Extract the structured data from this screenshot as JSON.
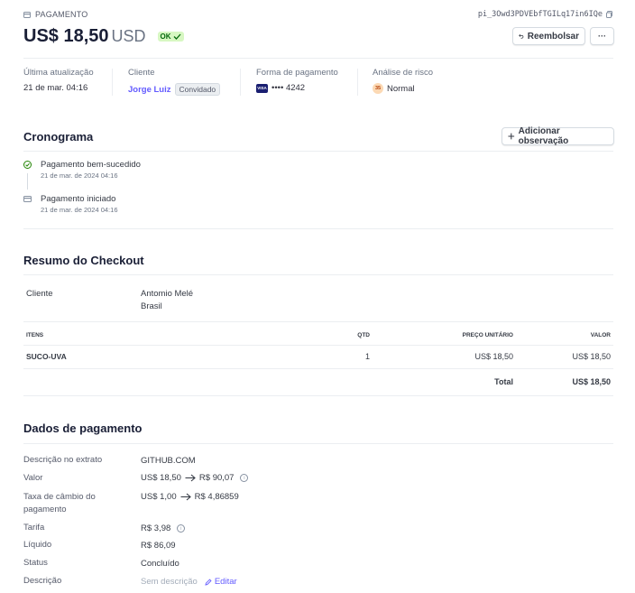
{
  "header": {
    "kicker": "PAGAMENTO",
    "payment_id": "pi_3Owd3PDVEbfTGILq17in6IQe",
    "amount": "US$ 18,50",
    "currency": "USD",
    "status_badge": "OK",
    "refund_label": "Reembolsar",
    "more_label": "···"
  },
  "summary": {
    "last_update_label": "Última atualização",
    "last_update_value": "21 de mar. 04:16",
    "customer_label": "Cliente",
    "customer_name": "Jorge Luiz",
    "customer_badge": "Convidado",
    "payment_method_label": "Forma de pagamento",
    "card_brand": "VISA",
    "card_last4": "•••• 4242",
    "risk_label": "Análise de risco",
    "risk_score": "35",
    "risk_level": "Normal"
  },
  "timeline": {
    "title": "Cronograma",
    "add_note_label": "Adicionar observação",
    "events": [
      {
        "title": "Pagamento bem-sucedido",
        "time": "21 de mar. de 2024 04:16"
      },
      {
        "title": "Pagamento iniciado",
        "time": "21 de mar. de 2024 04:16"
      }
    ]
  },
  "checkout": {
    "title": "Resumo do Checkout",
    "customer_label": "Cliente",
    "customer_name": "Antomio Melé",
    "customer_country": "Brasil",
    "columns": {
      "items": "ITENS",
      "qty": "QTD",
      "unit_price": "PREÇO UNITÁRIO",
      "value": "VALOR"
    },
    "rows": [
      {
        "item": "SUCO-UVA",
        "qty": "1",
        "unit_price": "US$ 18,50",
        "value": "US$ 18,50"
      }
    ],
    "total_label": "Total",
    "total_value": "US$ 18,50"
  },
  "payment_details": {
    "title": "Dados de pagamento",
    "statement_label": "Descrição no extrato",
    "statement_value": "GITHUB.COM",
    "value_label": "Valor",
    "value_from": "US$ 18,50",
    "value_to": "R$ 90,07",
    "fx_label": "Taxa de câmbio do pagamento",
    "fx_from": "US$ 1,00",
    "fx_to": "R$ 4,86859",
    "fee_label": "Tarifa",
    "fee_value": "R$ 3,98",
    "net_label": "Líquido",
    "net_value": "R$ 86,09",
    "status_label": "Status",
    "status_value": "Concluído",
    "description_label": "Descrição",
    "description_value": "Sem descrição",
    "edit_label": "Editar"
  }
}
